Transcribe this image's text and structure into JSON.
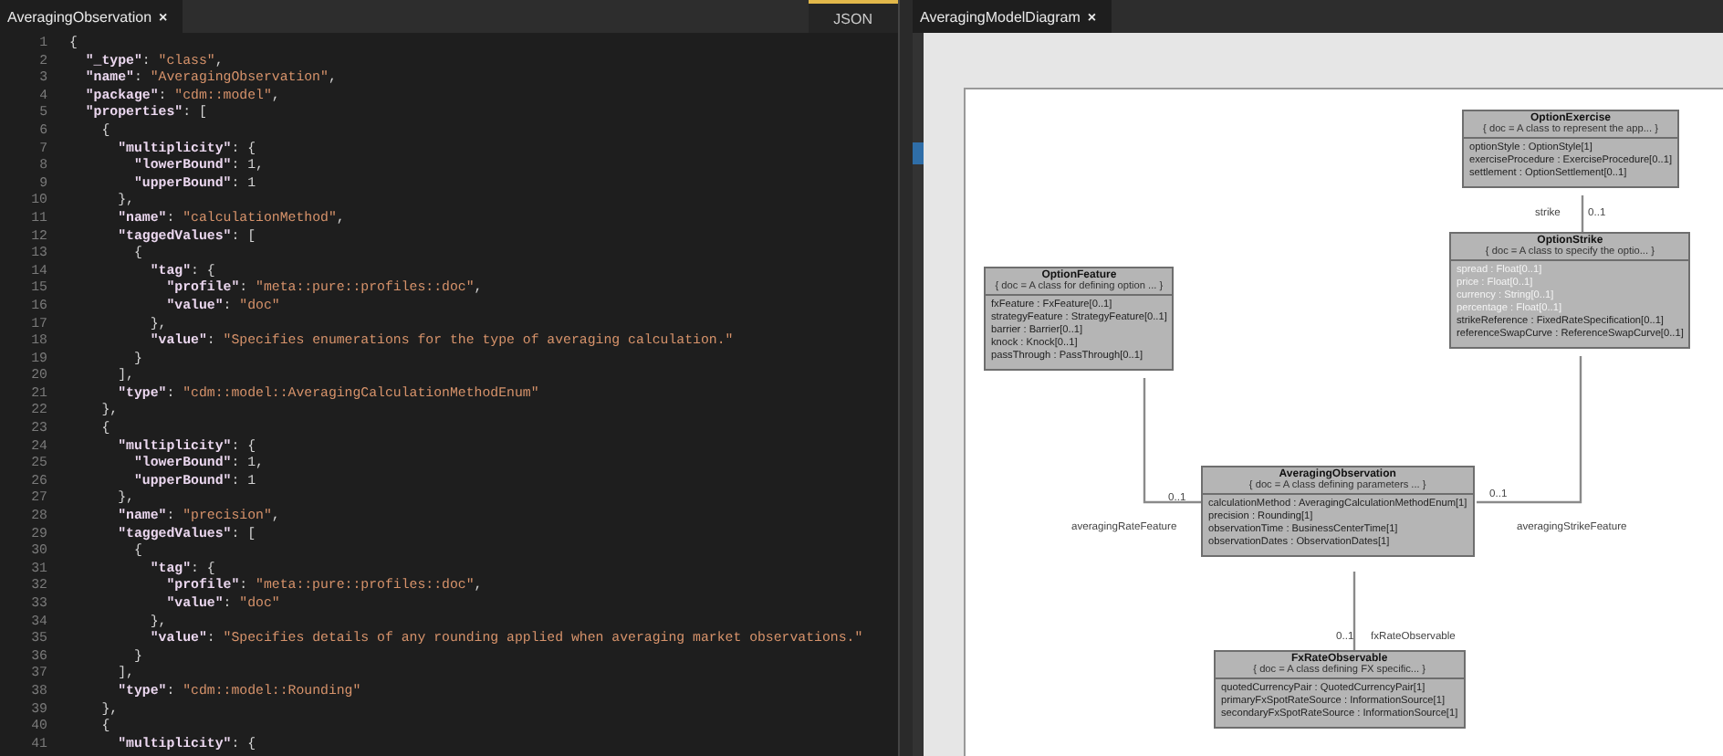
{
  "editor": {
    "tab": {
      "label": "AveragingObservation",
      "close": "×",
      "selected": true
    },
    "language": "JSON",
    "lines": [
      {
        "number": "1",
        "tokens": [
          {
            "kind": "punct",
            "text": "{"
          }
        ]
      },
      {
        "number": "2",
        "tokens": [
          {
            "kind": "key",
            "text": "  \"_type\""
          },
          {
            "kind": "punct",
            "text": ": "
          },
          {
            "kind": "string",
            "text": "\"class\""
          },
          {
            "kind": "punct",
            "text": ","
          }
        ]
      },
      {
        "number": "3",
        "tokens": [
          {
            "kind": "key",
            "text": "  \"name\""
          },
          {
            "kind": "punct",
            "text": ": "
          },
          {
            "kind": "string",
            "text": "\"AveragingObservation\""
          },
          {
            "kind": "punct",
            "text": ","
          }
        ]
      },
      {
        "number": "4",
        "tokens": [
          {
            "kind": "key",
            "text": "  \"package\""
          },
          {
            "kind": "punct",
            "text": ": "
          },
          {
            "kind": "string",
            "text": "\"cdm::model\""
          },
          {
            "kind": "punct",
            "text": ","
          }
        ]
      },
      {
        "number": "5",
        "tokens": [
          {
            "kind": "key",
            "text": "  \"properties\""
          },
          {
            "kind": "punct",
            "text": ": ["
          }
        ]
      },
      {
        "number": "6",
        "tokens": [
          {
            "kind": "punct",
            "text": "    {"
          }
        ]
      },
      {
        "number": "7",
        "tokens": [
          {
            "kind": "key",
            "text": "      \"multiplicity\""
          },
          {
            "kind": "punct",
            "text": ": {"
          }
        ]
      },
      {
        "number": "8",
        "tokens": [
          {
            "kind": "key",
            "text": "        \"lowerBound\""
          },
          {
            "kind": "punct",
            "text": ": 1,"
          }
        ]
      },
      {
        "number": "9",
        "tokens": [
          {
            "kind": "key",
            "text": "        \"upperBound\""
          },
          {
            "kind": "punct",
            "text": ": 1"
          }
        ]
      },
      {
        "number": "10",
        "tokens": [
          {
            "kind": "punct",
            "text": "      },"
          }
        ]
      },
      {
        "number": "11",
        "tokens": [
          {
            "kind": "key",
            "text": "      \"name\""
          },
          {
            "kind": "punct",
            "text": ": "
          },
          {
            "kind": "string",
            "text": "\"calculationMethod\""
          },
          {
            "kind": "punct",
            "text": ","
          }
        ]
      },
      {
        "number": "12",
        "tokens": [
          {
            "kind": "key",
            "text": "      \"taggedValues\""
          },
          {
            "kind": "punct",
            "text": ": ["
          }
        ]
      },
      {
        "number": "13",
        "tokens": [
          {
            "kind": "punct",
            "text": "        {"
          }
        ]
      },
      {
        "number": "14",
        "tokens": [
          {
            "kind": "key",
            "text": "          \"tag\""
          },
          {
            "kind": "punct",
            "text": ": {"
          }
        ]
      },
      {
        "number": "15",
        "tokens": [
          {
            "kind": "key",
            "text": "            \"profile\""
          },
          {
            "kind": "punct",
            "text": ": "
          },
          {
            "kind": "string",
            "text": "\"meta::pure::profiles::doc\""
          },
          {
            "kind": "punct",
            "text": ","
          }
        ]
      },
      {
        "number": "16",
        "tokens": [
          {
            "kind": "key",
            "text": "            \"value\""
          },
          {
            "kind": "punct",
            "text": ": "
          },
          {
            "kind": "string",
            "text": "\"doc\""
          }
        ]
      },
      {
        "number": "17",
        "tokens": [
          {
            "kind": "punct",
            "text": "          },"
          }
        ]
      },
      {
        "number": "18",
        "tokens": [
          {
            "kind": "key",
            "text": "          \"value\""
          },
          {
            "kind": "punct",
            "text": ": "
          },
          {
            "kind": "string",
            "text": "\"Specifies enumerations for the type of averaging calculation.\""
          }
        ]
      },
      {
        "number": "19",
        "tokens": [
          {
            "kind": "punct",
            "text": "        }"
          }
        ]
      },
      {
        "number": "20",
        "tokens": [
          {
            "kind": "punct",
            "text": "      ],"
          }
        ]
      },
      {
        "number": "21",
        "tokens": [
          {
            "kind": "key",
            "text": "      \"type\""
          },
          {
            "kind": "punct",
            "text": ": "
          },
          {
            "kind": "string",
            "text": "\"cdm::model::AveragingCalculationMethodEnum\""
          }
        ]
      },
      {
        "number": "22",
        "tokens": [
          {
            "kind": "punct",
            "text": "    },"
          }
        ]
      },
      {
        "number": "23",
        "tokens": [
          {
            "kind": "punct",
            "text": "    {"
          }
        ]
      },
      {
        "number": "24",
        "tokens": [
          {
            "kind": "key",
            "text": "      \"multiplicity\""
          },
          {
            "kind": "punct",
            "text": ": {"
          }
        ]
      },
      {
        "number": "25",
        "tokens": [
          {
            "kind": "key",
            "text": "        \"lowerBound\""
          },
          {
            "kind": "punct",
            "text": ": 1,"
          }
        ]
      },
      {
        "number": "26",
        "tokens": [
          {
            "kind": "key",
            "text": "        \"upperBound\""
          },
          {
            "kind": "punct",
            "text": ": 1"
          }
        ]
      },
      {
        "number": "27",
        "tokens": [
          {
            "kind": "punct",
            "text": "      },"
          }
        ]
      },
      {
        "number": "28",
        "tokens": [
          {
            "kind": "key",
            "text": "      \"name\""
          },
          {
            "kind": "punct",
            "text": ": "
          },
          {
            "kind": "string",
            "text": "\"precision\""
          },
          {
            "kind": "punct",
            "text": ","
          }
        ]
      },
      {
        "number": "29",
        "tokens": [
          {
            "kind": "key",
            "text": "      \"taggedValues\""
          },
          {
            "kind": "punct",
            "text": ": ["
          }
        ]
      },
      {
        "number": "30",
        "tokens": [
          {
            "kind": "punct",
            "text": "        {"
          }
        ]
      },
      {
        "number": "31",
        "tokens": [
          {
            "kind": "key",
            "text": "          \"tag\""
          },
          {
            "kind": "punct",
            "text": ": {"
          }
        ]
      },
      {
        "number": "32",
        "tokens": [
          {
            "kind": "key",
            "text": "            \"profile\""
          },
          {
            "kind": "punct",
            "text": ": "
          },
          {
            "kind": "string",
            "text": "\"meta::pure::profiles::doc\""
          },
          {
            "kind": "punct",
            "text": ","
          }
        ]
      },
      {
        "number": "33",
        "tokens": [
          {
            "kind": "key",
            "text": "            \"value\""
          },
          {
            "kind": "punct",
            "text": ": "
          },
          {
            "kind": "string",
            "text": "\"doc\""
          }
        ]
      },
      {
        "number": "34",
        "tokens": [
          {
            "kind": "punct",
            "text": "          },"
          }
        ]
      },
      {
        "number": "35",
        "tokens": [
          {
            "kind": "key",
            "text": "          \"value\""
          },
          {
            "kind": "punct",
            "text": ": "
          },
          {
            "kind": "string",
            "text": "\"Specifies details of any rounding applied when averaging market observations.\""
          }
        ]
      },
      {
        "number": "36",
        "tokens": [
          {
            "kind": "punct",
            "text": "        }"
          }
        ]
      },
      {
        "number": "37",
        "tokens": [
          {
            "kind": "punct",
            "text": "      ],"
          }
        ]
      },
      {
        "number": "38",
        "tokens": [
          {
            "kind": "key",
            "text": "      \"type\""
          },
          {
            "kind": "punct",
            "text": ": "
          },
          {
            "kind": "string",
            "text": "\"cdm::model::Rounding\""
          }
        ]
      },
      {
        "number": "39",
        "tokens": [
          {
            "kind": "punct",
            "text": "    },"
          }
        ]
      },
      {
        "number": "40",
        "tokens": [
          {
            "kind": "punct",
            "text": "    {"
          }
        ]
      },
      {
        "number": "41",
        "tokens": [
          {
            "kind": "key",
            "text": "      \"multiplicity\""
          },
          {
            "kind": "punct",
            "text": ": {"
          }
        ]
      }
    ]
  },
  "diagram": {
    "tab": {
      "label": "AveragingModelDiagram",
      "close": "×",
      "selected": true
    },
    "classes": [
      {
        "name": "OptionExercise",
        "doc": "{ doc = A class to represent the app... }",
        "attributes": [
          {
            "text": "optionStyle : OptionStyle[1]",
            "highlighted": false
          },
          {
            "text": "exerciseProcedure : ExerciseProcedure[0..1]",
            "highlighted": false
          },
          {
            "text": "settlement : OptionSettlement[0..1]",
            "highlighted": false
          }
        ]
      },
      {
        "name": "OptionStrike",
        "doc": "{ doc = A class to specify the optio... }",
        "attributes": [
          {
            "text": "spread : Float[0..1]",
            "highlighted": true
          },
          {
            "text": "price : Float[0..1]",
            "highlighted": true
          },
          {
            "text": "currency : String[0..1]",
            "highlighted": true
          },
          {
            "text": "percentage : Float[0..1]",
            "highlighted": true
          },
          {
            "text": "strikeReference : FixedRateSpecification[0..1]",
            "highlighted": false
          },
          {
            "text": "referenceSwapCurve : ReferenceSwapCurve[0..1]",
            "highlighted": false
          }
        ]
      },
      {
        "name": "OptionFeature",
        "doc": "{ doc = A class for defining option ... }",
        "attributes": [
          {
            "text": "fxFeature : FxFeature[0..1]",
            "highlighted": false
          },
          {
            "text": "strategyFeature : StrategyFeature[0..1]",
            "highlighted": false
          },
          {
            "text": "barrier : Barrier[0..1]",
            "highlighted": false
          },
          {
            "text": "knock : Knock[0..1]",
            "highlighted": false
          },
          {
            "text": "passThrough : PassThrough[0..1]",
            "highlighted": false
          }
        ]
      },
      {
        "name": "AveragingObservation",
        "doc": "{ doc = A class defining parameters ... }",
        "attributes": [
          {
            "text": "calculationMethod : AveragingCalculationMethodEnum[1]",
            "highlighted": false
          },
          {
            "text": "precision : Rounding[1]",
            "highlighted": false
          },
          {
            "text": "observationTime : BusinessCenterTime[1]",
            "highlighted": false
          },
          {
            "text": "observationDates : ObservationDates[1]",
            "highlighted": false
          }
        ]
      },
      {
        "name": "FxRateObservable",
        "doc": "{ doc = A class defining FX specific... }",
        "attributes": [
          {
            "text": "quotedCurrencyPair : QuotedCurrencyPair[1]",
            "highlighted": false
          },
          {
            "text": "primaryFxSpotRateSource : InformationSource[1]",
            "highlighted": false
          },
          {
            "text": "secondaryFxSpotRateSource : InformationSource[1]",
            "highlighted": false
          }
        ]
      }
    ],
    "associations": [
      {
        "role": "strike",
        "multiplicity": "0..1"
      },
      {
        "role": "averagingRateFeature",
        "multiplicity": "0..1"
      },
      {
        "role": "averagingStrikeFeature",
        "multiplicity": "0..1"
      },
      {
        "role": "fxRateObservable",
        "multiplicity": "0..1"
      }
    ]
  }
}
